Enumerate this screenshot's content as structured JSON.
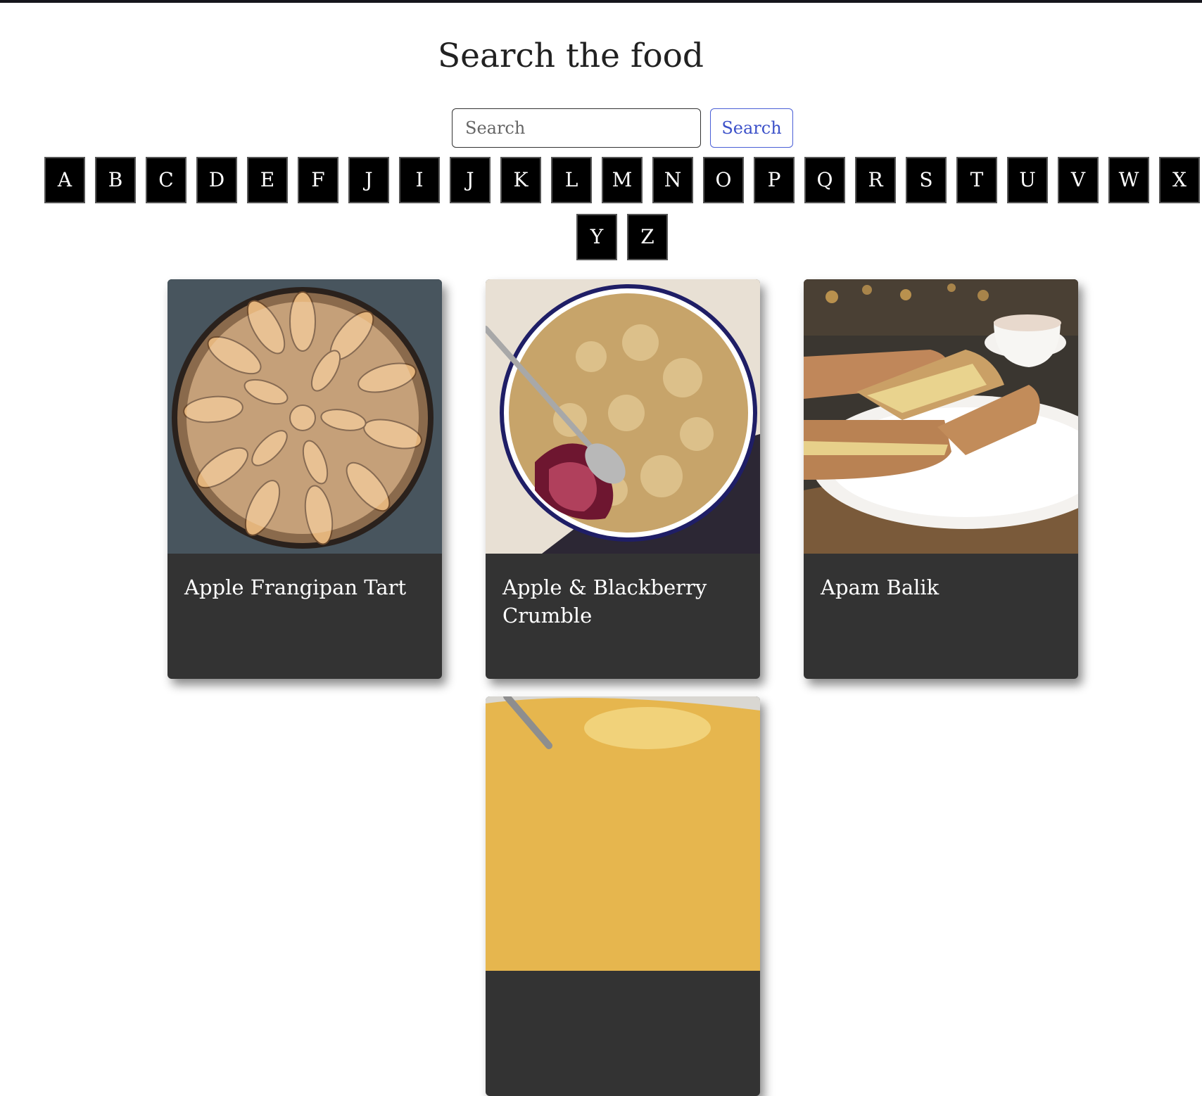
{
  "page": {
    "title": "Search the food"
  },
  "search": {
    "placeholder": "Search",
    "button_label": "Search"
  },
  "alphabet": {
    "row1": [
      "A",
      "B",
      "C",
      "D",
      "E",
      "F",
      "J",
      "I",
      "J",
      "K",
      "L",
      "M",
      "N",
      "O",
      "P",
      "Q",
      "R",
      "S",
      "T",
      "U",
      "V",
      "W",
      "X"
    ],
    "row2": [
      "Y",
      "Z"
    ]
  },
  "meals": [
    {
      "name": "Apple Frangipan Tart"
    },
    {
      "name": "Apple & Blackberry Crumble"
    },
    {
      "name": "Apam Balik"
    },
    {
      "name": ""
    }
  ],
  "colors": {
    "card_background": "#333333",
    "letter_background": "#000000",
    "search_button_text": "#3c51c9",
    "top_rule": "#15151c"
  }
}
